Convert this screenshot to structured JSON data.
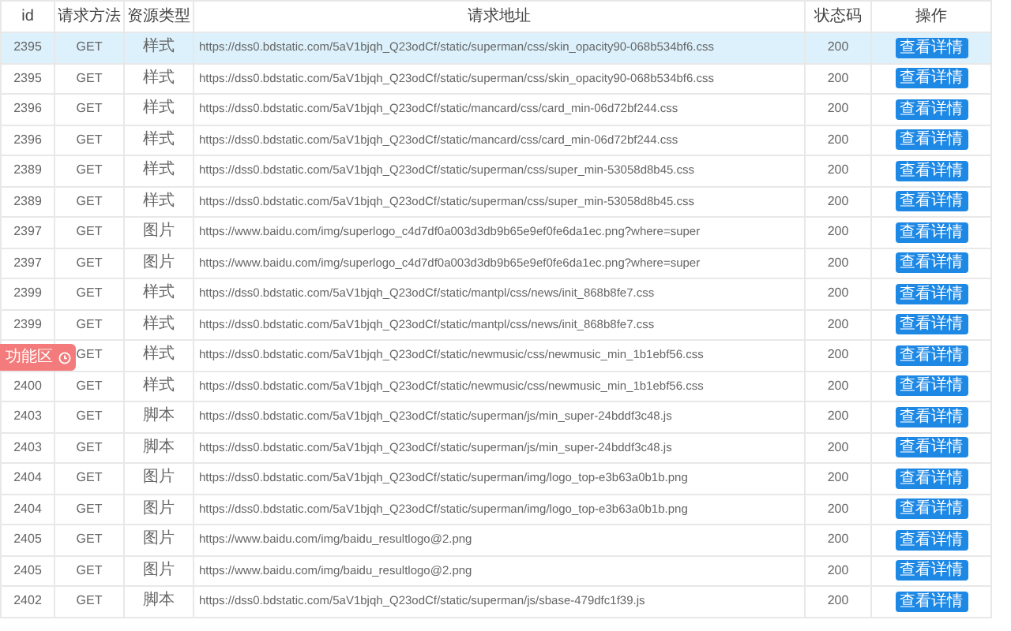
{
  "table": {
    "columns": [
      "id",
      "请求方法",
      "资源类型",
      "请求地址",
      "状态码",
      "操作"
    ],
    "rows": [
      {
        "id": "2395",
        "method": "GET",
        "type": "样式",
        "url": "https://dss0.bdstatic.com/5aV1bjqh_Q23odCf/static/superman/css/skin_opacity90-068b534bf6.css",
        "status": "200",
        "action": "查看详情",
        "selected": true
      },
      {
        "id": "2395",
        "method": "GET",
        "type": "样式",
        "url": "https://dss0.bdstatic.com/5aV1bjqh_Q23odCf/static/superman/css/skin_opacity90-068b534bf6.css",
        "status": "200",
        "action": "查看详情",
        "selected": false
      },
      {
        "id": "2396",
        "method": "GET",
        "type": "样式",
        "url": "https://dss0.bdstatic.com/5aV1bjqh_Q23odCf/static/mancard/css/card_min-06d72bf244.css",
        "status": "200",
        "action": "查看详情",
        "selected": false
      },
      {
        "id": "2396",
        "method": "GET",
        "type": "样式",
        "url": "https://dss0.bdstatic.com/5aV1bjqh_Q23odCf/static/mancard/css/card_min-06d72bf244.css",
        "status": "200",
        "action": "查看详情",
        "selected": false
      },
      {
        "id": "2389",
        "method": "GET",
        "type": "样式",
        "url": "https://dss0.bdstatic.com/5aV1bjqh_Q23odCf/static/superman/css/super_min-53058d8b45.css",
        "status": "200",
        "action": "查看详情",
        "selected": false
      },
      {
        "id": "2389",
        "method": "GET",
        "type": "样式",
        "url": "https://dss0.bdstatic.com/5aV1bjqh_Q23odCf/static/superman/css/super_min-53058d8b45.css",
        "status": "200",
        "action": "查看详情",
        "selected": false
      },
      {
        "id": "2397",
        "method": "GET",
        "type": "图片",
        "url": "https://www.baidu.com/img/superlogo_c4d7df0a003d3db9b65e9ef0fe6da1ec.png?where=super",
        "status": "200",
        "action": "查看详情",
        "selected": false
      },
      {
        "id": "2397",
        "method": "GET",
        "type": "图片",
        "url": "https://www.baidu.com/img/superlogo_c4d7df0a003d3db9b65e9ef0fe6da1ec.png?where=super",
        "status": "200",
        "action": "查看详情",
        "selected": false
      },
      {
        "id": "2399",
        "method": "GET",
        "type": "样式",
        "url": "https://dss0.bdstatic.com/5aV1bjqh_Q23odCf/static/mantpl/css/news/init_868b8fe7.css",
        "status": "200",
        "action": "查看详情",
        "selected": false
      },
      {
        "id": "2399",
        "method": "GET",
        "type": "样式",
        "url": "https://dss0.bdstatic.com/5aV1bjqh_Q23odCf/static/mantpl/css/news/init_868b8fe7.css",
        "status": "200",
        "action": "查看详情",
        "selected": false
      },
      {
        "method": "GET",
        "type": "样式",
        "url": "https://dss0.bdstatic.com/5aV1bjqh_Q23odCf/static/newmusic/css/newmusic_min_1b1ebf56.css",
        "status": "200",
        "action": "查看详情",
        "selected": false
      },
      {
        "id": "2400",
        "method": "GET",
        "type": "样式",
        "url": "https://dss0.bdstatic.com/5aV1bjqh_Q23odCf/static/newmusic/css/newmusic_min_1b1ebf56.css",
        "status": "200",
        "action": "查看详情",
        "selected": false
      },
      {
        "id": "2403",
        "method": "GET",
        "type": "脚本",
        "url": "https://dss0.bdstatic.com/5aV1bjqh_Q23odCf/static/superman/js/min_super-24bddf3c48.js",
        "status": "200",
        "action": "查看详情",
        "selected": false
      },
      {
        "id": "2403",
        "method": "GET",
        "type": "脚本",
        "url": "https://dss0.bdstatic.com/5aV1bjqh_Q23odCf/static/superman/js/min_super-24bddf3c48.js",
        "status": "200",
        "action": "查看详情",
        "selected": false
      },
      {
        "id": "2404",
        "method": "GET",
        "type": "图片",
        "url": "https://dss0.bdstatic.com/5aV1bjqh_Q23odCf/static/superman/img/logo_top-e3b63a0b1b.png",
        "status": "200",
        "action": "查看详情",
        "selected": false
      },
      {
        "id": "2404",
        "method": "GET",
        "type": "图片",
        "url": "https://dss0.bdstatic.com/5aV1bjqh_Q23odCf/static/superman/img/logo_top-e3b63a0b1b.png",
        "status": "200",
        "action": "查看详情",
        "selected": false
      },
      {
        "id": "2405",
        "method": "GET",
        "type": "图片",
        "url": "https://www.baidu.com/img/baidu_resultlogo@2.png",
        "status": "200",
        "action": "查看详情",
        "selected": false
      },
      {
        "id": "2405",
        "method": "GET",
        "type": "图片",
        "url": "https://www.baidu.com/img/baidu_resultlogo@2.png",
        "status": "200",
        "action": "查看详情",
        "selected": false
      },
      {
        "id": "2402",
        "method": "GET",
        "type": "脚本",
        "url": "https://dss0.bdstatic.com/5aV1bjqh_Q23odCf/static/superman/js/sbase-479dfc1f39.js",
        "status": "200",
        "action": "查看详情",
        "selected": false
      }
    ]
  },
  "floating_tab": {
    "label": "功能区"
  }
}
